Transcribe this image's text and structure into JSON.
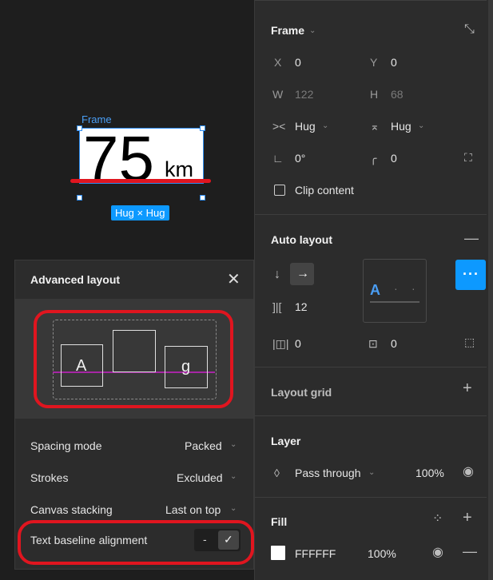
{
  "canvas": {
    "frame_label": "Frame",
    "number": "75",
    "unit": "km",
    "hug_badge": "Hug × Hug"
  },
  "frame_section": {
    "title": "Frame",
    "x_label": "X",
    "x_value": "0",
    "y_label": "Y",
    "y_value": "0",
    "w_label": "W",
    "w_value": "122",
    "h_label": "H",
    "h_value": "68",
    "hw_value": "Hug",
    "hh_value": "Hug",
    "rotation": "0°",
    "radius": "0",
    "clip_content": "Clip content"
  },
  "auto_layout": {
    "title": "Auto layout",
    "gap_value": "12",
    "padding_h": "0",
    "padding_v": "0",
    "preview_letter": "A"
  },
  "layout_grid": {
    "title": "Layout grid"
  },
  "layer": {
    "title": "Layer",
    "blend": "Pass through",
    "opacity": "100%"
  },
  "fill": {
    "title": "Fill",
    "hex": "FFFFFF",
    "opacity": "100%"
  },
  "advanced_layout": {
    "title": "Advanced layout",
    "box_a": "A",
    "box_g": "g",
    "rows": [
      {
        "label": "Spacing mode",
        "value": "Packed"
      },
      {
        "label": "Strokes",
        "value": "Excluded"
      },
      {
        "label": "Canvas stacking",
        "value": "Last on top"
      }
    ],
    "baseline_label": "Text baseline alignment",
    "toggle_off": "-",
    "toggle_on": "✓"
  },
  "colors": {
    "accent": "#0d99ff",
    "highlight": "#e0151f",
    "baseline": "#a626a4"
  }
}
